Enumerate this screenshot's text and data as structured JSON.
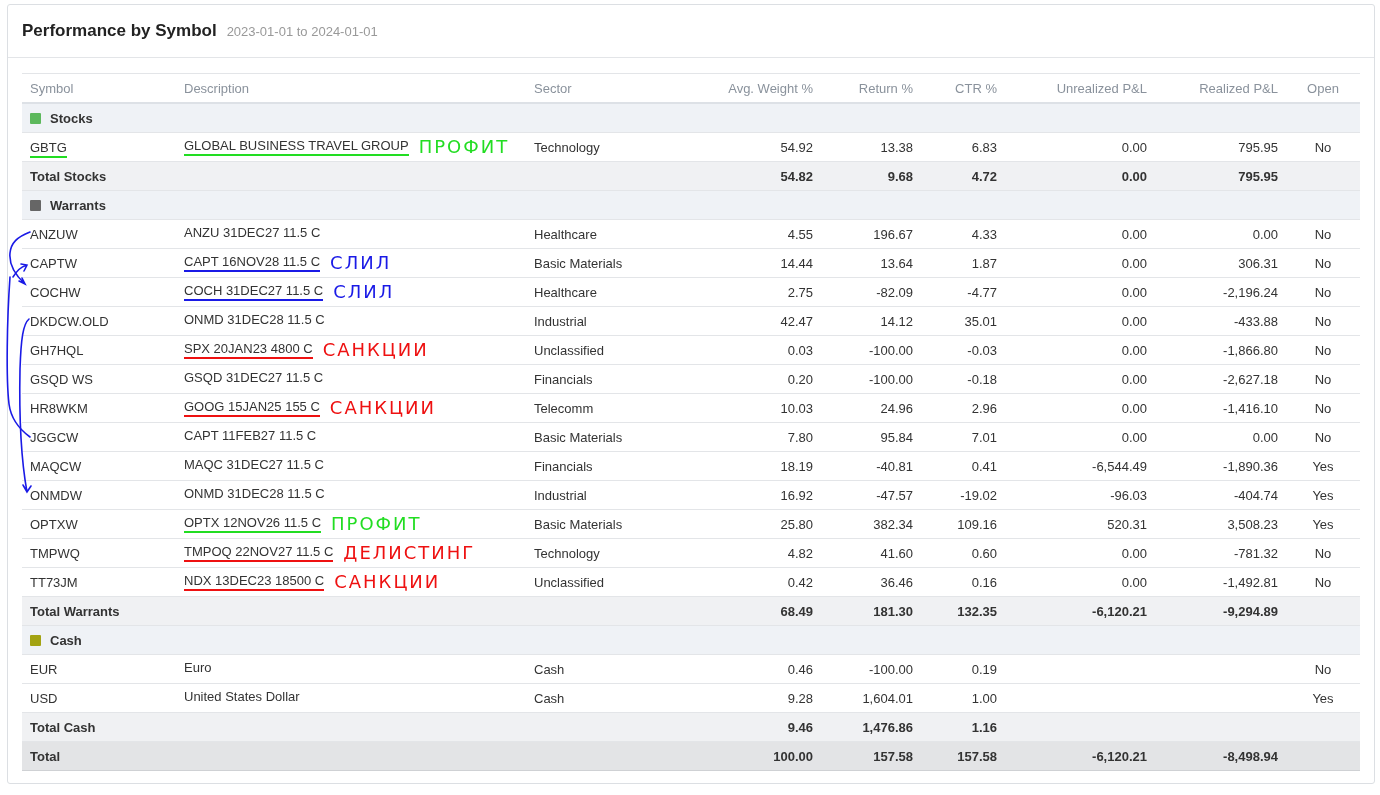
{
  "title": "Performance by Symbol",
  "date_range": "2023-01-01 to 2024-01-01",
  "columns": [
    "Symbol",
    "Description",
    "Sector",
    "Avg. Weight %",
    "Return %",
    "CTR %",
    "Unrealized P&L",
    "Realized P&L",
    "Open"
  ],
  "rows": [
    {
      "kind": "group",
      "name": "Stocks",
      "color": "#5cb85c"
    },
    {
      "kind": "row",
      "symbol": "GBTG",
      "description": "GLOBAL BUSINESS TRAVEL GROUP",
      "sector": "Technology",
      "avg_weight": "54.92",
      "return": "13.38",
      "ctr": "6.83",
      "unrealized_pl": "0.00",
      "realized_pl": "795.95",
      "open": "No",
      "note": {
        "text": "ПРОФИТ",
        "color": "#22dd22",
        "underline_symbol": true
      }
    },
    {
      "kind": "total",
      "symbol": "Total Stocks",
      "avg_weight": "54.82",
      "return": "9.68",
      "ctr": "4.72",
      "unrealized_pl": "0.00",
      "realized_pl": "795.95"
    },
    {
      "kind": "group",
      "name": "Warrants",
      "color": "#666666"
    },
    {
      "kind": "row",
      "symbol": "ANZUW",
      "description": "ANZU 31DEC27 11.5 C",
      "sector": "Healthcare",
      "avg_weight": "4.55",
      "return": "196.67",
      "ctr": "4.33",
      "unrealized_pl": "0.00",
      "realized_pl": "0.00",
      "open": "No"
    },
    {
      "kind": "row",
      "symbol": "CAPTW",
      "description": "CAPT 16NOV28 11.5 C",
      "sector": "Basic Materials",
      "avg_weight": "14.44",
      "return": "13.64",
      "ctr": "1.87",
      "unrealized_pl": "0.00",
      "realized_pl": "306.31",
      "open": "No",
      "note": {
        "text": "СЛИЛ",
        "color": "#1a1ae6",
        "underline_symbol": false
      }
    },
    {
      "kind": "row",
      "symbol": "COCHW",
      "description": "COCH 31DEC27 11.5 C",
      "sector": "Healthcare",
      "avg_weight": "2.75",
      "return": "-82.09",
      "ctr": "-4.77",
      "unrealized_pl": "0.00",
      "realized_pl": "-2,196.24",
      "open": "No",
      "note": {
        "text": "СЛИЛ",
        "color": "#1a1ae6",
        "underline_symbol": false
      }
    },
    {
      "kind": "row",
      "symbol": "DKDCW.OLD",
      "description": "ONMD 31DEC28 11.5 C",
      "sector": "Industrial",
      "avg_weight": "42.47",
      "return": "14.12",
      "ctr": "35.01",
      "unrealized_pl": "0.00",
      "realized_pl": "-433.88",
      "open": "No"
    },
    {
      "kind": "row",
      "symbol": "GH7HQL",
      "description": "SPX 20JAN23 4800 C",
      "sector": "Unclassified",
      "avg_weight": "0.03",
      "return": "-100.00",
      "ctr": "-0.03",
      "unrealized_pl": "0.00",
      "realized_pl": "-1,866.80",
      "open": "No",
      "note": {
        "text": "САНКЦИИ",
        "color": "#ee1111",
        "underline_symbol": false
      }
    },
    {
      "kind": "row",
      "symbol": "GSQD WS",
      "description": "GSQD 31DEC27 11.5 C",
      "sector": "Financials",
      "avg_weight": "0.20",
      "return": "-100.00",
      "ctr": "-0.18",
      "unrealized_pl": "0.00",
      "realized_pl": "-2,627.18",
      "open": "No"
    },
    {
      "kind": "row",
      "symbol": "HR8WKM",
      "description": "GOOG 15JAN25 155 C",
      "sector": "Telecomm",
      "avg_weight": "10.03",
      "return": "24.96",
      "ctr": "2.96",
      "unrealized_pl": "0.00",
      "realized_pl": "-1,416.10",
      "open": "No",
      "note": {
        "text": "САНКЦИИ",
        "color": "#ee1111",
        "underline_symbol": false
      }
    },
    {
      "kind": "row",
      "symbol": "JGGCW",
      "description": "CAPT 11FEB27 11.5 C",
      "sector": "Basic Materials",
      "avg_weight": "7.80",
      "return": "95.84",
      "ctr": "7.01",
      "unrealized_pl": "0.00",
      "realized_pl": "0.00",
      "open": "No"
    },
    {
      "kind": "row",
      "symbol": "MAQCW",
      "description": "MAQC 31DEC27 11.5 C",
      "sector": "Financials",
      "avg_weight": "18.19",
      "return": "-40.81",
      "ctr": "0.41",
      "unrealized_pl": "-6,544.49",
      "realized_pl": "-1,890.36",
      "open": "Yes"
    },
    {
      "kind": "row",
      "symbol": "ONMDW",
      "description": "ONMD 31DEC28 11.5 C",
      "sector": "Industrial",
      "avg_weight": "16.92",
      "return": "-47.57",
      "ctr": "-19.02",
      "unrealized_pl": "-96.03",
      "realized_pl": "-404.74",
      "open": "Yes"
    },
    {
      "kind": "row",
      "symbol": "OPTXW",
      "description": "OPTX 12NOV26 11.5 C",
      "sector": "Basic Materials",
      "avg_weight": "25.80",
      "return": "382.34",
      "ctr": "109.16",
      "unrealized_pl": "520.31",
      "realized_pl": "3,508.23",
      "open": "Yes",
      "note": {
        "text": "ПРОФИТ",
        "color": "#22dd22",
        "underline_symbol": false
      }
    },
    {
      "kind": "row",
      "symbol": "TMPWQ",
      "description": "TMPOQ 22NOV27 11.5 C",
      "sector": "Technology",
      "avg_weight": "4.82",
      "return": "41.60",
      "ctr": "0.60",
      "unrealized_pl": "0.00",
      "realized_pl": "-781.32",
      "open": "No",
      "note": {
        "text": "ДЕЛИСТИНГ",
        "color": "#ee1111",
        "underline_symbol": false
      }
    },
    {
      "kind": "row",
      "symbol": "TT73JM",
      "description": "NDX 13DEC23 18500 C",
      "sector": "Unclassified",
      "avg_weight": "0.42",
      "return": "36.46",
      "ctr": "0.16",
      "unrealized_pl": "0.00",
      "realized_pl": "-1,492.81",
      "open": "No",
      "note": {
        "text": "САНКЦИИ",
        "color": "#ee1111",
        "underline_symbol": false
      }
    },
    {
      "kind": "total",
      "symbol": "Total Warrants",
      "avg_weight": "68.49",
      "return": "181.30",
      "ctr": "132.35",
      "unrealized_pl": "-6,120.21",
      "realized_pl": "-9,294.89"
    },
    {
      "kind": "group",
      "name": "Cash",
      "color": "#a3a312"
    },
    {
      "kind": "row",
      "symbol": "EUR",
      "description": "Euro",
      "sector": "Cash",
      "avg_weight": "0.46",
      "return": "-100.00",
      "ctr": "0.19",
      "open": "No"
    },
    {
      "kind": "row",
      "symbol": "USD",
      "description": "United States Dollar",
      "sector": "Cash",
      "avg_weight": "9.28",
      "return": "1,604.01",
      "ctr": "1.00",
      "open": "Yes"
    },
    {
      "kind": "total",
      "symbol": "Total Cash",
      "avg_weight": "9.46",
      "return": "1,476.86",
      "ctr": "1.16"
    },
    {
      "kind": "grand_total",
      "symbol": "Total",
      "avg_weight": "100.00",
      "return": "157.58",
      "ctr": "157.58",
      "unrealized_pl": "-6,120.21",
      "realized_pl": "-8,498.94"
    }
  ]
}
